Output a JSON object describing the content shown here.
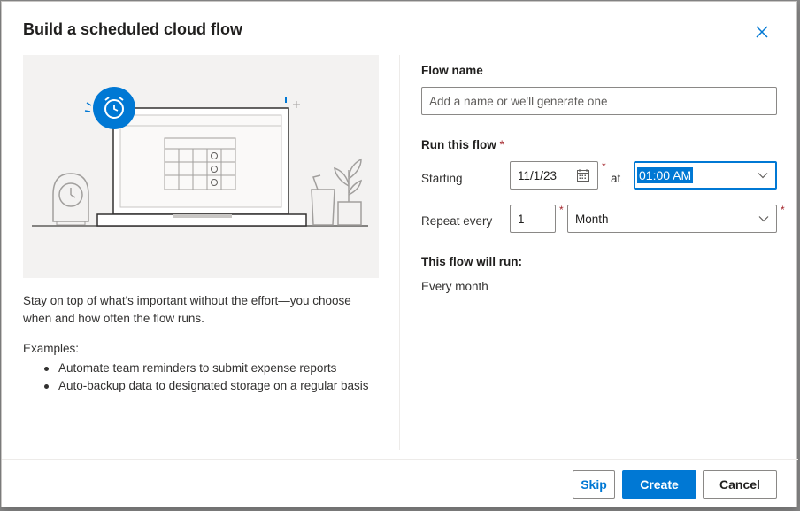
{
  "dialog": {
    "title": "Build a scheduled cloud flow"
  },
  "left": {
    "description": "Stay on top of what's important without the effort—you choose when and how often the flow runs.",
    "examples_title": "Examples:",
    "examples": [
      "Automate team reminders to submit expense reports",
      "Auto-backup data to designated storage on a regular basis"
    ]
  },
  "form": {
    "flow_name_label": "Flow name",
    "flow_name_placeholder": "Add a name or we'll generate one",
    "run_label": "Run this flow",
    "required_mark": "*",
    "starting_label": "Starting",
    "start_date": "11/1/23",
    "at_label": "at",
    "start_time": "01:00 AM",
    "repeat_label": "Repeat every",
    "repeat_interval": "1",
    "repeat_unit": "Month",
    "summary_label": "This flow will run:",
    "summary_value": "Every month"
  },
  "buttons": {
    "skip": "Skip",
    "create": "Create",
    "cancel": "Cancel"
  },
  "colors": {
    "accent": "#0078d4",
    "required": "#a4262c",
    "illustration_bg": "#f3f2f1"
  }
}
